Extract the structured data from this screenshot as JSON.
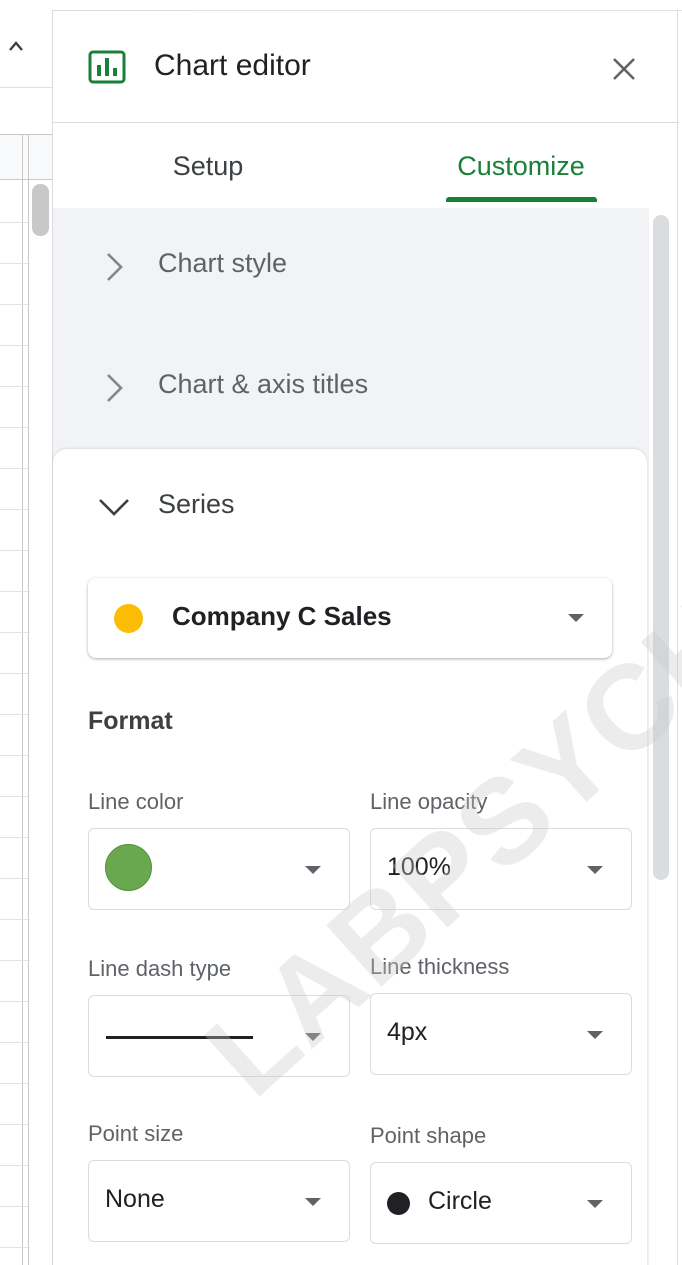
{
  "header": {
    "title": "Chart editor",
    "chart_icon": "bar-chart-icon",
    "close_icon": "close-icon"
  },
  "tabs": [
    {
      "label": "Setup",
      "active": false
    },
    {
      "label": "Customize",
      "active": true
    }
  ],
  "sections": [
    {
      "label": "Chart style",
      "expanded": false
    },
    {
      "label": "Chart & axis titles",
      "expanded": false
    },
    {
      "label": "Series",
      "expanded": true
    }
  ],
  "series": {
    "selected": "Company C Sales",
    "color": "#fbbc04"
  },
  "format": {
    "title": "Format",
    "line_color": {
      "label": "Line color",
      "value": "#6aa84f"
    },
    "line_opacity": {
      "label": "Line opacity",
      "value": "100%"
    },
    "line_dash_type": {
      "label": "Line dash type",
      "value": "solid"
    },
    "line_thickness": {
      "label": "Line thickness",
      "value": "4px"
    },
    "point_size": {
      "label": "Point size",
      "value": "None"
    },
    "point_shape": {
      "label": "Point shape",
      "value": "Circle"
    }
  },
  "watermark": "LABPSYCHO",
  "colors": {
    "accent": "#188038",
    "text_dark": "#202124",
    "text_muted": "#5f6368"
  }
}
